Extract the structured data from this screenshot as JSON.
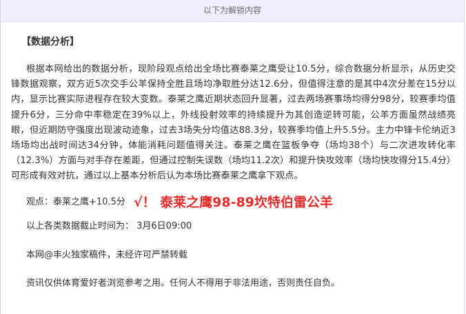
{
  "banner": {
    "text": "以下为解锁内容"
  },
  "article": {
    "heading": "【数据分析】",
    "analysis": "根据本网给出的数据分析，现阶段观点给出全场比赛泰莱之鹰受让10.5分，综合数据分析显示，从历史交锋数据观察，双方近5次交手公羊保持全胜且场均净取胜分达12.6分，但值得注意的是其中4次分差在15分以内，显示比赛实际进程存在较大变数。泰莱之鹰近期状态回升显著，过去两场赛事场均得分98分，较赛季均值提升6分，三分命中率稳定在39%以上，外线投射效率的持续提升为其创造逆转可能，公羊方面虽然战绩亮眼，但近期防守强度出现波动迹象，过去3场失分均值达88.3分，较赛季均值上升5.5分。主力中锋卡伦纳近3场场均出战时间达34分钟，体能消耗问题值得关注。泰莱之鹰在篮板争夺（场均38个）与二次进攻转化率（12.3%）方面与对手存在差距，但通过控制失误数（场均11.2次）和提升快攻效率（场均快攻得分15.4分）可形成有效对抗，通过以上基本分析后认为本场比赛泰莱之鹰拿下观点。",
    "view_prefix": "观点：泰莱之鹰+10.5分",
    "view_highlight": "√！ 泰莱之鹰98-89坎特伯雷公羊",
    "data_time": "以上各类数据截止时间为： 3月6日09:00",
    "source": "本网@丰火独家稿件，未经许可严禁转载",
    "disclaimer": "资讯仅供体育爱好者浏览参考之用。任何人不得用于非法用途，否则责任自负。"
  },
  "colors": {
    "banner_bg": "#f1eefb",
    "highlight": "#e62b2b",
    "text": "#333333"
  }
}
